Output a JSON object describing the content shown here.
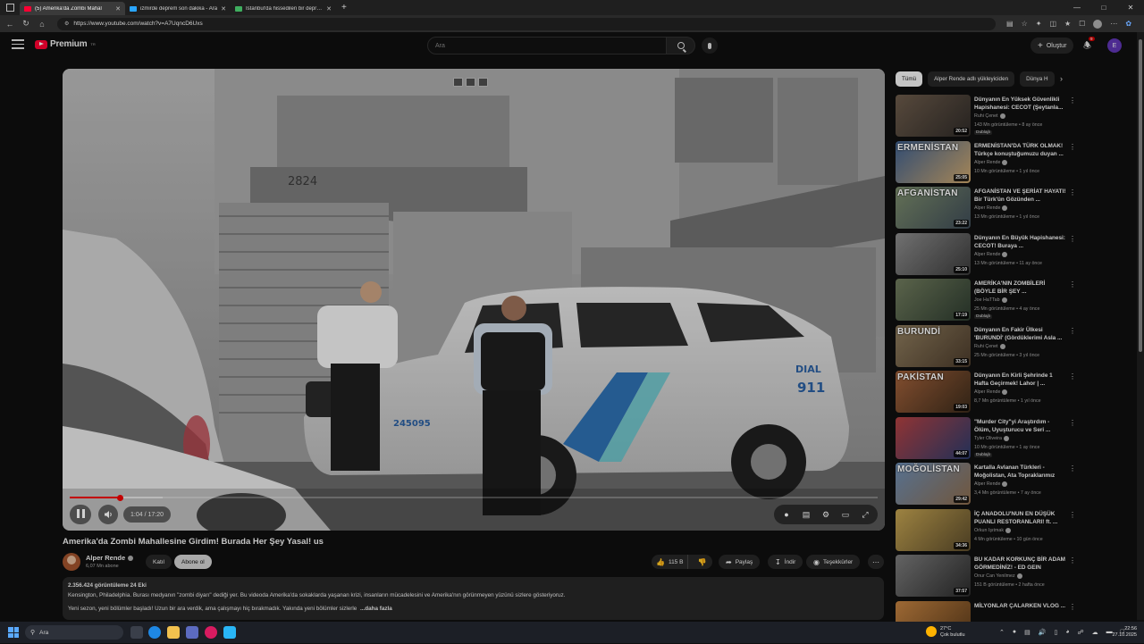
{
  "browser": {
    "tabs": [
      {
        "title": "(5) Amerika'da Zombi Mahal",
        "active": true,
        "favicon": "youtube-icon",
        "color": "#ff0033"
      },
      {
        "title": "izmirde deprem son dakika - Ara",
        "active": false,
        "favicon": "bing-icon",
        "color": "#2aa5ff"
      },
      {
        "title": "İstanbul'da hissedilen bir deprem",
        "active": false,
        "favicon": "news-icon",
        "color": "#3fae5f"
      }
    ],
    "url": "https://www.youtube.com/watch?v=A7UqncD6Uxs"
  },
  "yt_header": {
    "logo": "Premium",
    "logo_region": "TR",
    "search_placeholder": "Ara",
    "create_label": "Oluştur",
    "notif_count": "9",
    "user_initial": "E"
  },
  "player": {
    "time": "1:04 / 17:20",
    "progress_fraction": 0.062
  },
  "video": {
    "title": "Amerika'da Zombi Mahallesine Girdim! Burada Her Şey Yasal! us",
    "channel": "Alper Rende",
    "subscribers": "6,07 Mn abone",
    "join_label": "Katıl",
    "subscribe_label": "Abone ol",
    "likes": "115 B",
    "share_label": "Paylaş",
    "download_label": "İndir",
    "thanks_label": "Teşekkürler",
    "desc_stats": "2.356.424 görüntüleme  24 Eki",
    "desc_line1": "Kensington, Philadelphia. Burası medyanın \"zombi diyarı\" dediği yer. Bu videoda Amerika'da sokaklarda yaşanan krizi, insanların mücadelesini ve Amerika'nın görünmeyen yüzünü sizlere gösteriyoruz.",
    "desc_line2": "Yeni sezon, yeni bölümler başladı! Uzun bir ara verdik, ama çalışmayı hiç bırakmadık. Yakında yeni bölümler sizlerle",
    "desc_more": "...daha fazla"
  },
  "chips": [
    "Tümü",
    "Alper Rende adlı yükleyiciden",
    "Dünya H"
  ],
  "recommendations": [
    {
      "title": "Dünyanın En Yüksek Güvenlikli Hapishanesi: CECOT (Şeytanla...",
      "channel": "Ruhi Çenet",
      "meta": "143 Mn görüntüleme • 8 ay önce",
      "badge": "Dublajlı",
      "duration": "20:52",
      "overlay": "",
      "c1": "#6b5a4a",
      "c2": "#2e2a27"
    },
    {
      "title": "ERMENİSTAN'DA TÜRK OLMAK! Türkçe konuştuğumuzu duyan ...",
      "channel": "Alper Rende",
      "meta": "10 Mn görüntüleme • 1 yıl önce",
      "badge": "",
      "duration": "25:05",
      "overlay": "ERMENİSTAN",
      "c1": "#3d5e8c",
      "c2": "#c9a36a"
    },
    {
      "title": "AFGANİSTAN VE ŞERİAT HAYATI! Bir Türk'ün Gözünden ...",
      "channel": "Alper Rende",
      "meta": "13 Mn görüntüleme • 1 yıl önce",
      "badge": "",
      "duration": "23:22",
      "overlay": "AFGANİSTAN",
      "c1": "#7a8a6a",
      "c2": "#3d4a55"
    },
    {
      "title": "Dünyanın En Büyük Hapishanesi: CECOT! Buraya ...",
      "channel": "Alper Rende",
      "meta": "13 Mn görüntüleme • 11 ay önce",
      "badge": "",
      "duration": "25:10",
      "overlay": "",
      "c1": "#8a8a8a",
      "c2": "#3a3a3a"
    },
    {
      "title": "AMERİKA'NIN ZOMBİLERİ (BÖYLE BİR ŞEY ...",
      "channel": "Joe HaTTab",
      "meta": "25 Mn görüntüleme • 4 ay önce",
      "badge": "Dublajlı",
      "duration": "17:19",
      "overlay": "",
      "c1": "#6f7a5c",
      "c2": "#2c3a2e"
    },
    {
      "title": "Dünyanın En Fakir Ülkesi 'BURUNDİ' (Gördüklerimi Asla ...",
      "channel": "Ruhi Çenet",
      "meta": "25 Mn görüntüleme • 3 yıl önce",
      "badge": "",
      "duration": "33:15",
      "overlay": "BURUNDİ",
      "c1": "#8c7a5c",
      "c2": "#4a3a2a"
    },
    {
      "title": "Dünyanın En Kirli Şehrinde 1 Hafta Geçirmek! Lahor | ...",
      "channel": "Alper Rende",
      "meta": "8,7 Mn görüntüleme • 1 yıl önce",
      "badge": "",
      "duration": "19:03",
      "overlay": "PAKİSTAN",
      "c1": "#a0603a",
      "c2": "#3a2a1a"
    },
    {
      "title": "\"Murder City\"yi Araştırdım - Ölüm, Uyuşturucu ve Seri ...",
      "channel": "Tyler Oliveira",
      "meta": "10 Mn görüntüleme • 1 ay önce",
      "badge": "Dublajlı",
      "duration": "44:07",
      "overlay": "",
      "c1": "#b04040",
      "c2": "#2a3a6a"
    },
    {
      "title": "Kartalla Avlanan Türkleri - Moğolistan, Ata Topraklarımız",
      "channel": "Alper Rende",
      "meta": "3,4 Mn görüntüleme • 7 ay önce",
      "badge": "",
      "duration": "29:42",
      "overlay": "MOĞOLİSTAN",
      "c1": "#6a8ab0",
      "c2": "#8a6a4a"
    },
    {
      "title": "İÇ ANADOLU'NUN EN DÜŞÜK PUANLI RESTORANLARI! ft. ...",
      "channel": "Orkun Işıtmak",
      "meta": "4 Mn görüntüleme • 10 gün önce",
      "badge": "",
      "duration": "34:36",
      "overlay": "",
      "c1": "#c0a050",
      "c2": "#5a4a2a"
    },
    {
      "title": "BU KADAR KORKUNÇ BİR ADAM GÖRMEDİNİZ! - ED GEIN",
      "channel": "Onur Can Yenilmez",
      "meta": "151 B görüntüleme • 2 hafta önce",
      "badge": "",
      "duration": "37:57",
      "overlay": "",
      "c1": "#7a7a7a",
      "c2": "#2a2a2a"
    },
    {
      "title": "MİLYONLAR ÇALARKEN VLOG ...",
      "channel": "",
      "meta": "",
      "badge": "",
      "duration": "",
      "overlay": "",
      "c1": "#c08040",
      "c2": "#5a3a1a"
    }
  ],
  "taskbar": {
    "search_placeholder": "Ara",
    "weather_temp": "27°C",
    "weather_desc": "Çok bulutlu",
    "time": "22:56",
    "date": "27.10.2025"
  }
}
